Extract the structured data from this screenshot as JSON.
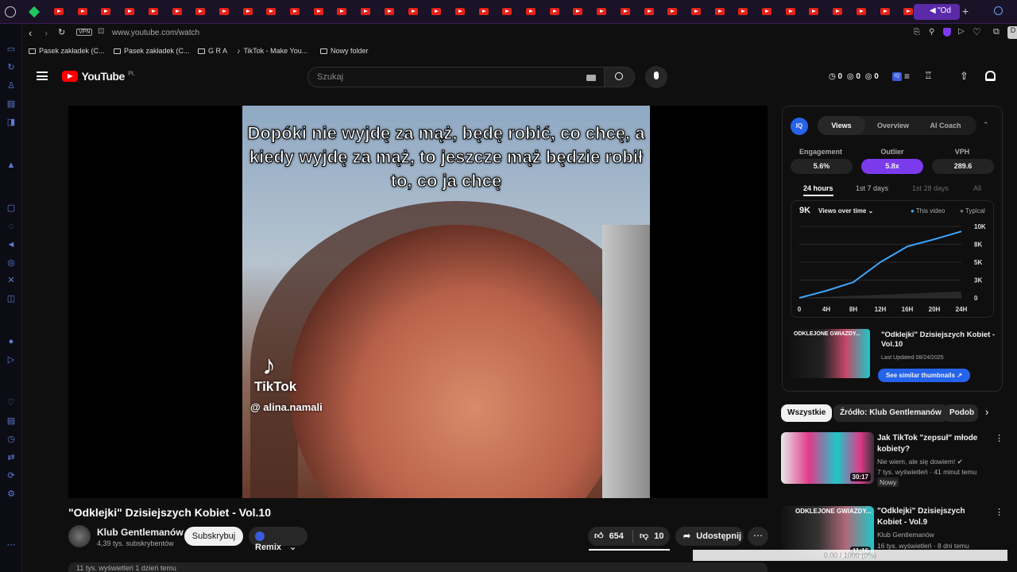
{
  "browser": {
    "active_tab_title": "\"Od",
    "address": "www.youtube.com/watch",
    "vpn_label": "VPN",
    "bookmarks": [
      "Pasek zakładek (C...",
      "Pasek zakładek (C...",
      "G R A",
      "TikTok - Make You...",
      "Nowy folder"
    ]
  },
  "header": {
    "logo_text": "YouTube",
    "country": "PL",
    "search_placeholder": "Szukaj",
    "counters": [
      "0",
      "0",
      "0"
    ]
  },
  "video": {
    "caption": "Dopóki nie wyjdę za mąż, będę robić, co chcę, a kiedy wyjdę za mąż, to jeszcze mąż będzie robił to, co ja chcę",
    "watermark_logo": "TikTok",
    "watermark_user": "@ alina.namali",
    "title": "\"Odklejki\" Dzisiejszych Kobiet - Vol.10",
    "channel": "Klub Gentlemanów",
    "subscribers": "4,39 tys. subskrybentów",
    "subscribe_label": "Subskrybuj",
    "remix_label": "Remix",
    "likes": "654",
    "dislikes": "10",
    "share_label": "Udostępnij",
    "description_preview": "11 tys. wyświetleń  1 dzień temu"
  },
  "iq": {
    "badge": "IQ",
    "tabs": [
      "Views",
      "Overview",
      "AI Coach"
    ],
    "stats": [
      {
        "label": "Engagement",
        "value": "5.6%"
      },
      {
        "label": "Outlier",
        "value": "5.8x"
      },
      {
        "label": "VPH",
        "value": "289.6"
      }
    ],
    "periods": [
      "24 hours",
      "1st 7 days",
      "1st 28 days",
      "All"
    ],
    "views_total": "9K",
    "views_dropdown": "Views over time",
    "legend_this": "This video",
    "legend_typical": "Typical",
    "thumb_title": "ODKLEJONE GWIAZDY...",
    "card_title": "\"Odklejki\" Dzisiejszych Kobiet - Vol.10",
    "last_updated": "Last Updated 08/24/2025",
    "similar_button": "See similar thumbnails ↗"
  },
  "chart_data": {
    "type": "line",
    "x": [
      "0",
      "4H",
      "8H",
      "12H",
      "16H",
      "20H",
      "24H"
    ],
    "series": [
      {
        "name": "This video",
        "values": [
          0,
          1000,
          2200,
          5000,
          7200,
          8200,
          9300
        ]
      }
    ],
    "yticks": [
      "10K",
      "8K",
      "5K",
      "3K",
      "0"
    ],
    "ylim": [
      0,
      10000
    ]
  },
  "chips": [
    "Wszystkie",
    "Źródło: Klub Gentlemanów",
    "Podob"
  ],
  "related": [
    {
      "title": "Jak TikTok \"zepsuł\" młode kobiety?",
      "channel": "Nie wiem, ale się dowiem!",
      "meta": "7 tys. wyświetleń · 41 minut temu",
      "badge": "Nowy",
      "duration": "30:17"
    },
    {
      "title": "\"Odklejki\" Dzisiejszych Kobiet - Vol.9",
      "channel": "Klub Gentlemanów",
      "meta": "16 tys. wyświetleń · 8 dni temu",
      "thumb_text": "ODKLEJONE GWIAZDY...",
      "duration": "11:16"
    }
  ],
  "overlay_progress": "0.00 / 1000 (0%)",
  "colors": {
    "accent": "#7c3aed",
    "yt_red": "#ff0000",
    "link_blue": "#3ea6ff"
  }
}
